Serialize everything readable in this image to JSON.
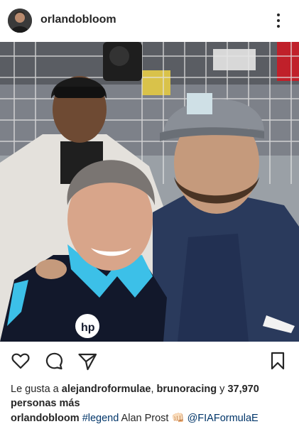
{
  "post": {
    "username": "orlandobloom"
  },
  "likes": {
    "prefix": "Le gusta a",
    "user1": "alejandroformulae",
    "separator": ",",
    "user2": "brunoracing",
    "connector": "y",
    "count": "37,970",
    "suffix": "personas más"
  },
  "caption": {
    "username": "orlandobloom",
    "hashtag": "#legend",
    "text": "Alan Prost",
    "emoji": "👊🏻",
    "mention": "@FIAFormulaE"
  },
  "icons": {
    "more": "more-options-icon",
    "like": "heart-icon",
    "comment": "comment-icon",
    "share": "share-icon",
    "save": "bookmark-icon"
  },
  "colors": {
    "text": "#262626",
    "link": "#003569"
  }
}
